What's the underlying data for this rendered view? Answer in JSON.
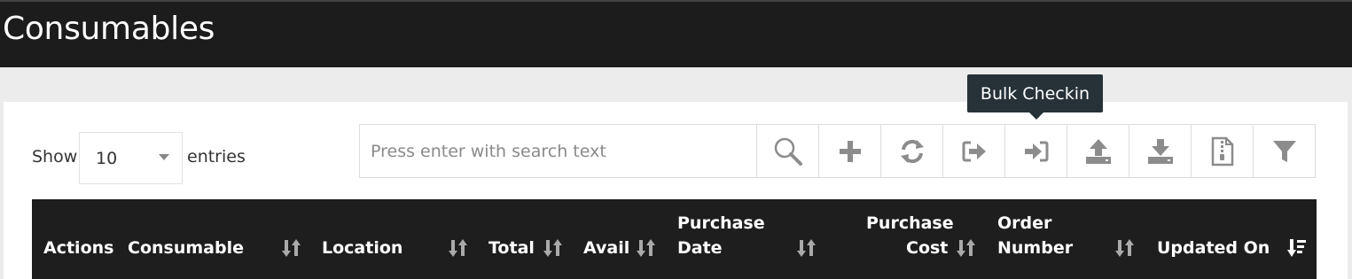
{
  "header": {
    "title": "Consumables"
  },
  "table_controls": {
    "show_label": "Show",
    "page_size": "10",
    "entries_label": "entries"
  },
  "search": {
    "placeholder": "Press enter with search text"
  },
  "toolbar": {
    "buttons": [
      "search-icon",
      "plus-icon",
      "refresh-icon",
      "checkout-icon",
      "checkin-icon",
      "upload-icon",
      "download-icon",
      "zip-file-icon",
      "filter-icon"
    ]
  },
  "tooltip": {
    "text": "Bulk Checkin"
  },
  "columns": {
    "actions": "Actions",
    "consumable": "Consumable",
    "location": "Location",
    "total": "Total",
    "avail": "Avail",
    "purchase_date_line1": "Purchase",
    "purchase_date_line2": "Date",
    "purchase_cost_line1": "Purchase",
    "purchase_cost_line2": "Cost",
    "order_number_line1": "Order",
    "order_number_line2": "Number",
    "updated_on": "Updated On"
  },
  "colors": {
    "topbar": "#1c1c1c",
    "table_header": "#1e1e1e",
    "tooltip": "#263238",
    "icon_gray": "#8c8c8c"
  }
}
